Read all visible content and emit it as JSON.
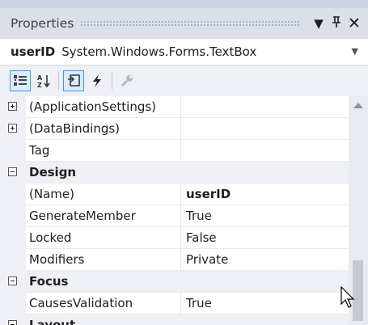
{
  "panel": {
    "title": "Properties",
    "pin_label": "▼",
    "autohide_label": "ꟼ",
    "close_label": "✕"
  },
  "object": {
    "name": "userID",
    "type": "System.Windows.Forms.TextBox"
  },
  "toolbar": {
    "buttons": [
      {
        "name": "categorized-view",
        "icon": "categorized-icon",
        "active": true
      },
      {
        "name": "alphabetical-view",
        "icon": "sort-az-icon",
        "active": false
      },
      {
        "name": "properties-view",
        "icon": "properties-icon",
        "active": true
      },
      {
        "name": "events-view",
        "icon": "lightning-icon",
        "active": false
      },
      {
        "name": "property-pages",
        "icon": "wrench-icon",
        "active": false
      }
    ]
  },
  "grid": {
    "rows": [
      {
        "kind": "item",
        "expander": "plus",
        "name": "(ApplicationSettings)",
        "value": ""
      },
      {
        "kind": "item",
        "expander": "plus",
        "name": "(DataBindings)",
        "value": ""
      },
      {
        "kind": "item",
        "expander": "",
        "name": "Tag",
        "value": ""
      },
      {
        "kind": "category",
        "expander": "minus",
        "name": "Design",
        "value": ""
      },
      {
        "kind": "item",
        "expander": "",
        "name": "(Name)",
        "value": "userID",
        "bold": true
      },
      {
        "kind": "item",
        "expander": "",
        "name": "GenerateMember",
        "value": "True"
      },
      {
        "kind": "item",
        "expander": "",
        "name": "Locked",
        "value": "False"
      },
      {
        "kind": "item",
        "expander": "",
        "name": "Modifiers",
        "value": "Private"
      },
      {
        "kind": "category",
        "expander": "minus",
        "name": "Focus",
        "value": ""
      },
      {
        "kind": "item",
        "expander": "",
        "name": "CausesValidation",
        "value": "True"
      },
      {
        "kind": "category",
        "expander": "minus",
        "name": "Layout",
        "value": ""
      }
    ]
  },
  "colors": {
    "titlebar": "#dadfe8",
    "toolbar": "#eef0f5",
    "active_border": "#3399ff"
  }
}
